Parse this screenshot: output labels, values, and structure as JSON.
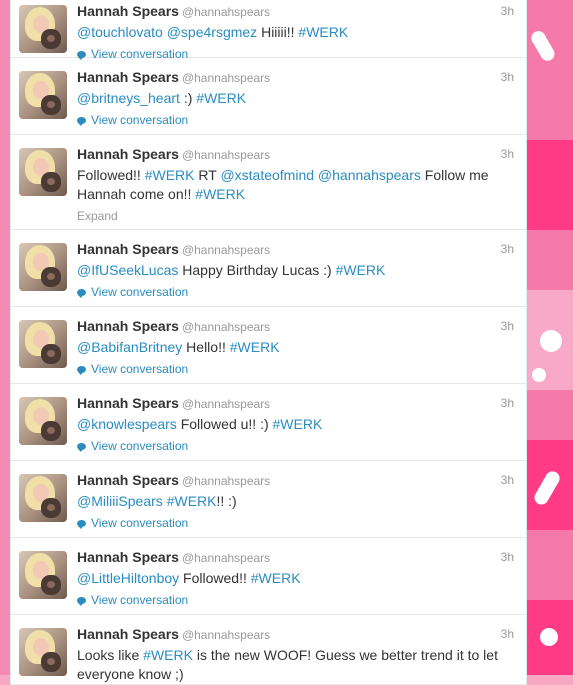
{
  "colors": {
    "link": "#2a8cc1",
    "background": "#f7a6c4"
  },
  "tweets": [
    {
      "name": "Hannah Spears",
      "handle": "@hannahspears",
      "time": "3h",
      "parts": [
        {
          "t": "@touchlovato",
          "link": true
        },
        {
          "t": " ",
          "link": false
        },
        {
          "t": "@spe4rsgmez",
          "link": true
        },
        {
          "t": " Hiiiii!! ",
          "link": false
        },
        {
          "t": "#WERK",
          "link": true
        }
      ],
      "action": "View conversation",
      "action_icon": "conversation-icon"
    },
    {
      "name": "Hannah Spears",
      "handle": "@hannahspears",
      "time": "3h",
      "parts": [
        {
          "t": "@britneys_heart",
          "link": true
        },
        {
          "t": " :) ",
          "link": false
        },
        {
          "t": "#WERK",
          "link": true
        }
      ],
      "action": "View conversation",
      "action_icon": "conversation-icon"
    },
    {
      "name": "Hannah Spears",
      "handle": "@hannahspears",
      "time": "3h",
      "parts": [
        {
          "t": "Followed!! ",
          "link": false
        },
        {
          "t": "#WERK",
          "link": true
        },
        {
          "t": " RT ",
          "link": false
        },
        {
          "t": "@xstateofmind",
          "link": true
        },
        {
          "t": " ",
          "link": false
        },
        {
          "t": "@hannahspears",
          "link": true
        },
        {
          "t": " Follow me Hannah come on!! ",
          "link": false
        },
        {
          "t": "#WERK",
          "link": true
        }
      ],
      "action": "Expand",
      "action_icon": ""
    },
    {
      "name": "Hannah Spears",
      "handle": "@hannahspears",
      "time": "3h",
      "parts": [
        {
          "t": "@IfUSeekLucas",
          "link": true
        },
        {
          "t": " Happy Birthday Lucas :) ",
          "link": false
        },
        {
          "t": "#WERK",
          "link": true
        }
      ],
      "action": "View conversation",
      "action_icon": "conversation-icon"
    },
    {
      "name": "Hannah Spears",
      "handle": "@hannahspears",
      "time": "3h",
      "parts": [
        {
          "t": "@BabifanBritney",
          "link": true
        },
        {
          "t": " Hello!! ",
          "link": false
        },
        {
          "t": "#WERK",
          "link": true
        }
      ],
      "action": "View conversation",
      "action_icon": "conversation-icon"
    },
    {
      "name": "Hannah Spears",
      "handle": "@hannahspears",
      "time": "3h",
      "parts": [
        {
          "t": "@knowlespears",
          "link": true
        },
        {
          "t": " Followed u!! :) ",
          "link": false
        },
        {
          "t": "#WERK",
          "link": true
        }
      ],
      "action": "View conversation",
      "action_icon": "conversation-icon"
    },
    {
      "name": "Hannah Spears",
      "handle": "@hannahspears",
      "time": "3h",
      "parts": [
        {
          "t": "@MiliiiSpears",
          "link": true
        },
        {
          "t": " ",
          "link": false
        },
        {
          "t": "#WERK",
          "link": true
        },
        {
          "t": "!! :)",
          "link": false
        }
      ],
      "action": "View conversation",
      "action_icon": "conversation-icon"
    },
    {
      "name": "Hannah Spears",
      "handle": "@hannahspears",
      "time": "3h",
      "parts": [
        {
          "t": "@LittleHiltonboy",
          "link": true
        },
        {
          "t": " Followed!! ",
          "link": false
        },
        {
          "t": "#WERK",
          "link": true
        }
      ],
      "action": "View conversation",
      "action_icon": "conversation-icon"
    },
    {
      "name": "Hannah Spears",
      "handle": "@hannahspears",
      "time": "3h",
      "parts": [
        {
          "t": "Looks like ",
          "link": false
        },
        {
          "t": "#WERK",
          "link": true
        },
        {
          "t": " is the new WOOF! Guess we better trend it to let everyone know ;)",
          "link": false
        }
      ],
      "action": "",
      "action_icon": ""
    }
  ]
}
